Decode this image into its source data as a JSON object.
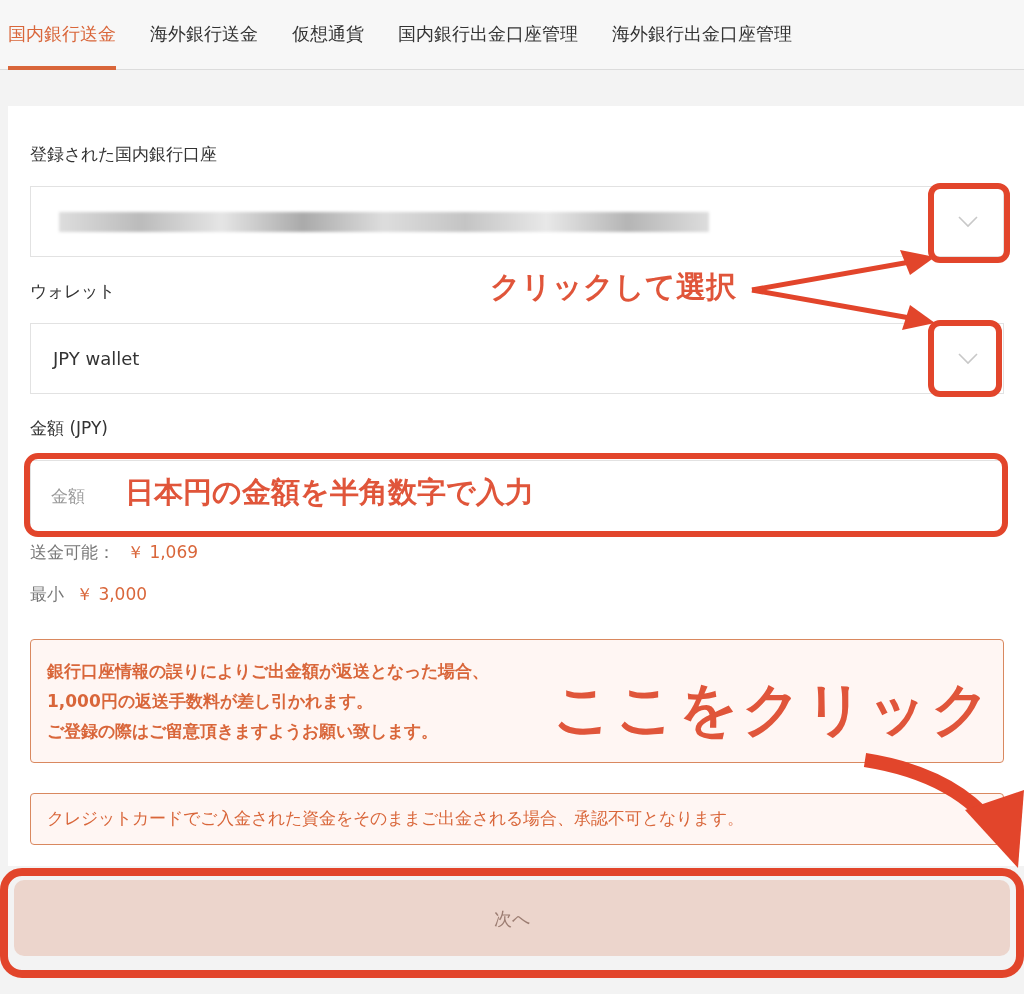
{
  "tabs": [
    {
      "label": "国内銀行送金",
      "selected": true
    },
    {
      "label": "海外銀行送金",
      "selected": false
    },
    {
      "label": "仮想通貨",
      "selected": false
    },
    {
      "label": "国内銀行出金口座管理",
      "selected": false
    },
    {
      "label": "海外銀行出金口座管理",
      "selected": false
    }
  ],
  "form": {
    "account": {
      "label": "登録された国内銀行口座"
    },
    "wallet": {
      "label": "ウォレット",
      "value": "JPY wallet"
    },
    "amount": {
      "label": "金額 (JPY)",
      "placeholder": "金額"
    },
    "available": {
      "label": "送金可能：",
      "value": "￥ 1,069"
    },
    "minimum": {
      "label": "最小",
      "value": "￥ 3,000"
    }
  },
  "notices": [
    {
      "kind": "warning",
      "lines": [
        "銀行口座情報の誤りによりご出金額が返送となった場合、",
        "1,000円の返送手数料が差し引かれます。",
        "ご登録の際はご留意頂きますようお願い致します。"
      ]
    },
    {
      "kind": "info",
      "lines": [
        "クレジットカードでご入金された資金をそのままご出金される場合、承認不可となります。"
      ]
    }
  ],
  "next_button": {
    "label": "次へ",
    "disabled": true
  },
  "annotations": [
    {
      "text": "クリックして選択"
    },
    {
      "text": "日本円の金額を半角数字で入力"
    },
    {
      "text": "ここをクリック"
    }
  ]
}
